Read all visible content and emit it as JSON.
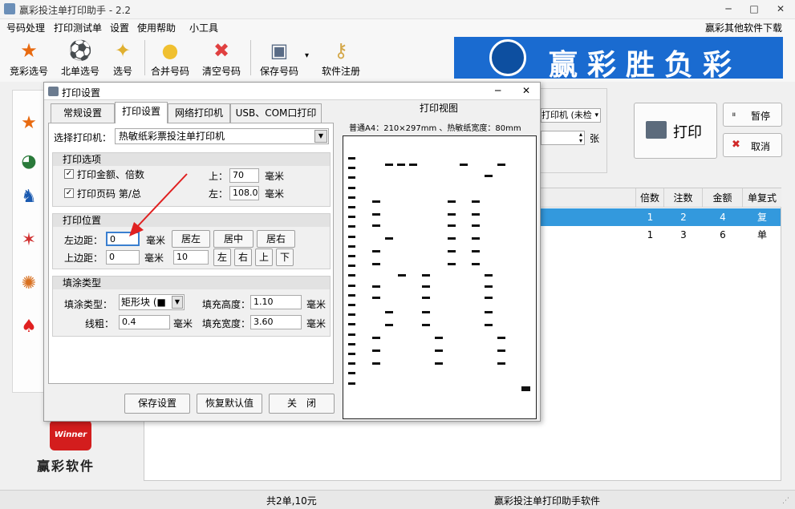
{
  "window": {
    "title": "赢彩投注单打印助手 - 2.2",
    "minimize": "─",
    "maximize": "□",
    "close": "✕"
  },
  "menu": {
    "items": [
      "号码处理",
      "打印测试单",
      "设置",
      "使用帮助",
      "小工具"
    ],
    "right_link": "赢彩其他软件下载"
  },
  "toolbar": {
    "items": [
      "竞彩选号",
      "北单选号",
      "选号",
      "合并号码",
      "清空号码",
      "保存号码",
      "软件注册"
    ],
    "dropdown_arrow": "▾"
  },
  "banner": {
    "text": "赢彩胜负彩"
  },
  "right_controls": {
    "printer_select": "打印机 (未检",
    "count_unit": "张",
    "print_label": "打印",
    "pause_label": "暂停",
    "cancel_label": "取消"
  },
  "table": {
    "columns": [
      "倍数",
      "注数",
      "金额",
      "单复式"
    ],
    "rows": [
      {
        "multiple": "1",
        "bets": "2",
        "amount": "4",
        "type": "复"
      },
      {
        "multiple": "1",
        "bets": "3",
        "amount": "6",
        "type": "单"
      }
    ],
    "selected_row": 0,
    "selected_color": "#3399dd"
  },
  "logo": {
    "brand": "Winner",
    "text": "赢彩软件"
  },
  "status": {
    "total": "共2单,10元",
    "app": "赢彩投注单打印助手软件"
  },
  "dialog": {
    "title": "打印设置",
    "close": "✕",
    "tabs": [
      "常规设置",
      "打印设置",
      "网络打印机",
      "USB、COM口打印机"
    ],
    "active_tab": 1,
    "printer_label": "选择打印机：",
    "printer_value": "热敏纸彩票投注单打印机",
    "print_options": {
      "header": "打印选项",
      "opt1": "打印金额、倍数",
      "opt2": "打印页码 第/总",
      "top_label": "上：",
      "top_value": "70",
      "left_label": "左：",
      "left_value": "108.0",
      "unit": "毫米"
    },
    "print_position": {
      "header": "打印位置",
      "left_margin_label": "左边距：",
      "left_margin_value": "0",
      "top_margin_label": "上边距：",
      "top_margin_value": "0",
      "unit": "毫米",
      "step_value": "10",
      "btn_left": "居左",
      "btn_center": "居中",
      "btn_right": "居右",
      "btn_l": "左",
      "btn_r": "右",
      "btn_up": "上",
      "btn_down": "下"
    },
    "fill": {
      "header": "填涂类型",
      "type_label": "填涂类型：",
      "type_value": "矩形块 (■",
      "height_label": "填充高度：",
      "height_value": "1.10",
      "line_label": "线粗：",
      "line_value": "0.4",
      "width_label": "填充宽度：",
      "width_value": "3.60",
      "unit": "毫米"
    },
    "buttons": {
      "save": "保存设置",
      "restore": "恢复默认值",
      "close": "关　闭"
    },
    "preview": {
      "title": "打印视图",
      "subtitle": "普通A4：210×297mm 、热敏纸宽度：80mm"
    }
  }
}
